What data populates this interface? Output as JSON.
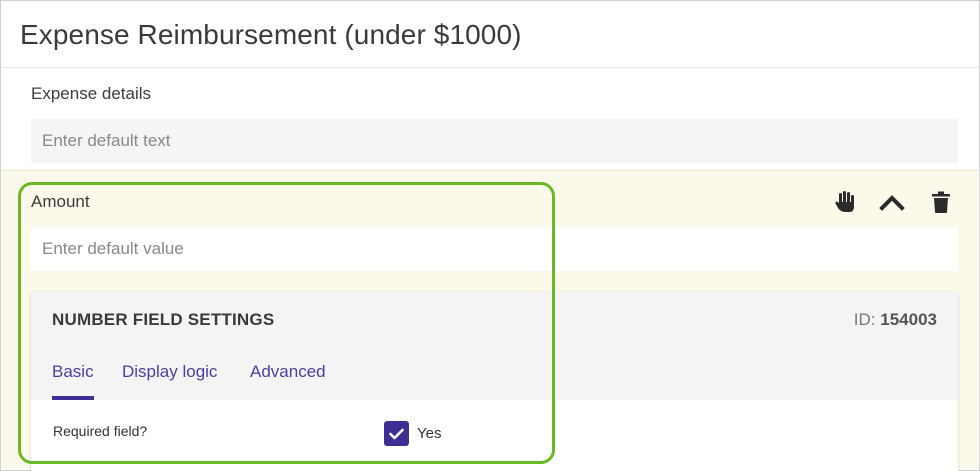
{
  "form": {
    "title": "Expense Reimbursement (under $1000)"
  },
  "expense_details": {
    "label": "Expense details",
    "placeholder": "Enter default text",
    "value": ""
  },
  "amount": {
    "label": "Amount",
    "placeholder": "Enter default value",
    "value": ""
  },
  "toolbar": {
    "icons": [
      "hand-drag-icon",
      "chevron-up-icon",
      "trash-icon"
    ]
  },
  "settings": {
    "title": "NUMBER FIELD SETTINGS",
    "id_label": "ID:",
    "id_value": "154003",
    "tabs": [
      {
        "label": "Basic",
        "active": true
      },
      {
        "label": "Display logic",
        "active": false
      },
      {
        "label": "Advanced",
        "active": false
      }
    ],
    "required_field": {
      "label": "Required field?",
      "checked": true,
      "option_label": "Yes"
    }
  },
  "colors": {
    "accent": "#3d2e94",
    "tab_text": "#4a3fa0",
    "highlight_border": "#6ab824",
    "active_section_bg": "#fbfaea"
  }
}
